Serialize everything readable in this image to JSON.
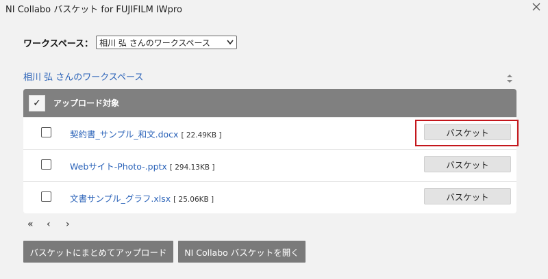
{
  "window": {
    "title": "NI Collabo バスケット for FUJIFILM IWpro"
  },
  "workspace": {
    "label": "ワークスペース：",
    "selected": "相川 弘 さんのワークスペース",
    "link": "相川 弘 さんのワークスペース"
  },
  "table": {
    "header_check": "✓",
    "header_label": "アップロード対象",
    "rows": [
      {
        "name": "契約書_サンプル_和文.docx",
        "size": "[ 22.49KB ]",
        "button": "バスケット"
      },
      {
        "name": "Webサイト-Photo-.pptx",
        "size": "[ 294.13KB ]",
        "button": "バスケット"
      },
      {
        "name": "文書サンプル_グラフ.xlsx",
        "size": "[ 25.06KB ]",
        "button": "バスケット"
      }
    ]
  },
  "pager": {
    "first": "«",
    "prev": "‹",
    "next": "›"
  },
  "actions": {
    "upload": "バスケットにまとめてアップロード",
    "open": "NI Collabo バスケットを開く"
  }
}
